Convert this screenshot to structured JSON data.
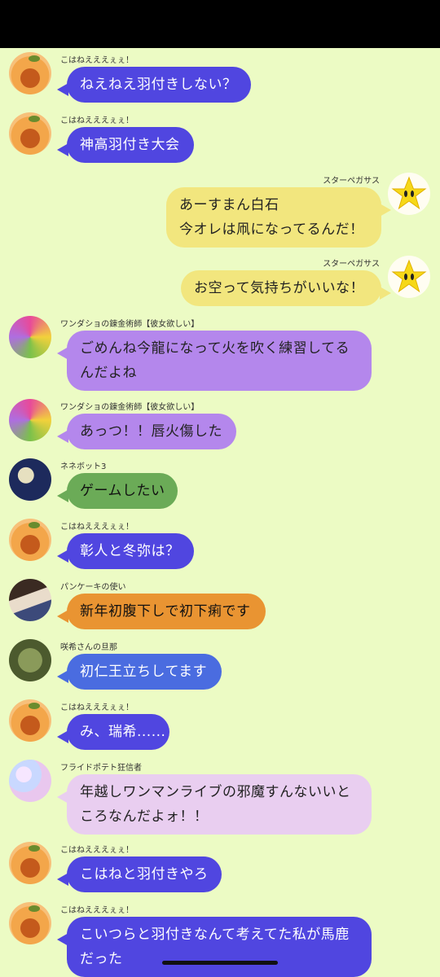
{
  "colors": {
    "background": "#ecfbc4",
    "status_bar": "#000000",
    "bubble_kohane": "#5046e0",
    "bubble_star": "#f2e67e",
    "bubble_wonder": "#b487ec",
    "bubble_nene": "#6bab57",
    "bubble_pancake": "#e99432",
    "bubble_saki": "#4a6ce0",
    "bubble_fried": "#e9cef0"
  },
  "messages": [
    {
      "sender": "こはねえええぇぇ！",
      "avatar_icon": "peach-icon",
      "side": "left",
      "lines": [
        "ねえねえ羽付きしない？"
      ]
    },
    {
      "sender": "こはねえええぇぇ！",
      "avatar_icon": "peach-icon",
      "side": "left",
      "lines": [
        "神高羽付き大会"
      ]
    },
    {
      "sender": "スターペガサス",
      "avatar_icon": "star-icon",
      "side": "right",
      "lines": [
        "あーすまん白石",
        "今オレは凧になってるんだ！"
      ]
    },
    {
      "sender": "スターペガサス",
      "avatar_icon": "star-icon",
      "side": "right",
      "lines": [
        "お空って気持ちがいいな！"
      ]
    },
    {
      "sender": "ワンダショの錬金術師【彼女欲しい】",
      "avatar_icon": "candy-icon",
      "side": "left",
      "lines": [
        "ごめんね今龍になって火を吹く練習してる",
        "んだよね"
      ]
    },
    {
      "sender": "ワンダショの錬金術師【彼女欲しい】",
      "avatar_icon": "candy-icon",
      "side": "left",
      "lines": [
        "あっつ！！唇火傷した"
      ]
    },
    {
      "sender": "ネネボット3",
      "avatar_icon": "night-icon",
      "side": "left",
      "lines": [
        "ゲームしたい"
      ]
    },
    {
      "sender": "こはねえええぇぇ！",
      "avatar_icon": "peach-icon",
      "side": "left",
      "lines": [
        "彰人と冬弥は？"
      ]
    },
    {
      "sender": "パンケーキの使い",
      "avatar_icon": "anime-boy-icon",
      "side": "left",
      "lines": [
        "新年初腹下しで初下痢です"
      ]
    },
    {
      "sender": "咲希さんの旦那",
      "avatar_icon": "plant-icon",
      "side": "left",
      "lines": [
        "初仁王立ちしてます"
      ]
    },
    {
      "sender": "こはねえええぇぇ！",
      "avatar_icon": "peach-icon",
      "side": "left",
      "lines": [
        "み、瑞希......"
      ]
    },
    {
      "sender": "フライドポテト狂信者",
      "avatar_icon": "glitter-icon",
      "side": "left",
      "lines": [
        "年越しワンマンライブの邪魔すんないいと",
        "ころなんだよォ！！"
      ]
    },
    {
      "sender": "こはねえええぇぇ！",
      "avatar_icon": "peach-icon",
      "side": "left",
      "lines": [
        "こはねと羽付きやろ"
      ]
    },
    {
      "sender": "こはねえええぇぇ！",
      "avatar_icon": "peach-icon",
      "side": "left",
      "lines": [
        "こいつらと羽付きなんて考えてた私が馬鹿",
        "だった"
      ]
    }
  ]
}
